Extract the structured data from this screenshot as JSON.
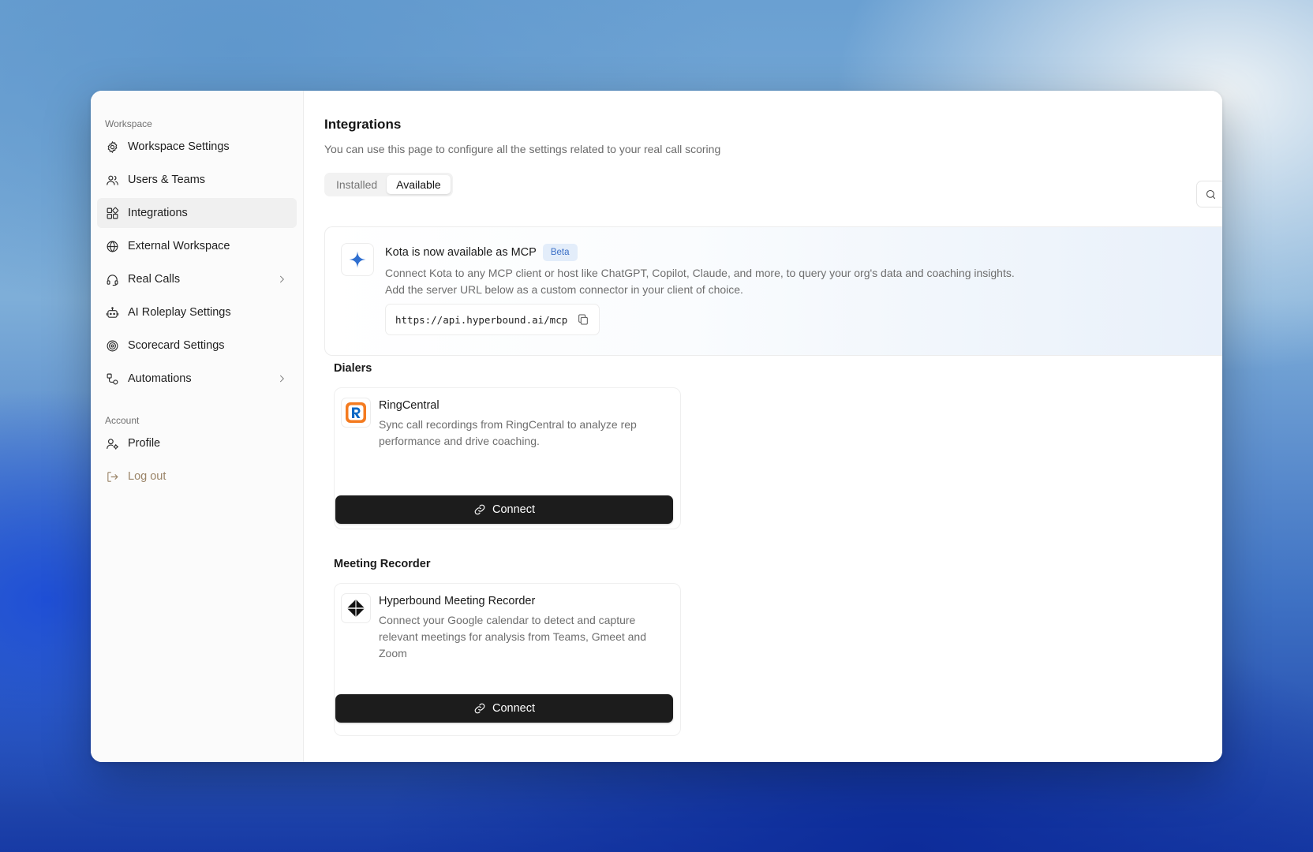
{
  "sidebar": {
    "workspace_label": "Workspace",
    "account_label": "Account",
    "items": [
      {
        "label": "Workspace Settings",
        "icon": "gear-icon"
      },
      {
        "label": "Users & Teams",
        "icon": "users-icon"
      },
      {
        "label": "Integrations",
        "icon": "integrations-icon",
        "active": true
      },
      {
        "label": "External Workspace",
        "icon": "globe-icon"
      },
      {
        "label": "Real Calls",
        "icon": "headset-icon",
        "has_submenu": true
      },
      {
        "label": "AI Roleplay Settings",
        "icon": "bot-icon"
      },
      {
        "label": "Scorecard Settings",
        "icon": "target-icon"
      },
      {
        "label": "Automations",
        "icon": "workflow-icon",
        "has_submenu": true
      }
    ],
    "account_items": [
      {
        "label": "Profile",
        "icon": "user-gear-icon"
      },
      {
        "label": "Log out",
        "icon": "logout-icon"
      }
    ]
  },
  "main": {
    "title": "Integrations",
    "subtitle": "You can use this page to configure all the settings related to your real call scoring",
    "tabs": [
      {
        "label": "Installed",
        "active": false
      },
      {
        "label": "Available",
        "active": true
      }
    ],
    "mcp": {
      "title": "Kota is now available as MCP",
      "badge": "Beta",
      "desc_line1": "Connect Kota to any MCP client or host like ChatGPT, Copilot, Claude, and more, to query your org's data and coaching insights.",
      "desc_line2": "Add the server URL below as a custom connector in your client of choice.",
      "url": "https://api.hyperbound.ai/mcp"
    },
    "groups": [
      {
        "title": "Dialers",
        "card": {
          "name": "RingCentral",
          "desc": "Sync call recordings from RingCentral to analyze rep performance and drive coaching.",
          "button": "Connect",
          "logo": "ringcentral-logo"
        }
      },
      {
        "title": "Meeting Recorder",
        "card": {
          "name": "Hyperbound Meeting Recorder",
          "desc": "Connect your Google calendar to detect and capture relevant meetings for analysis from Teams, Gmeet and Zoom",
          "button": "Connect",
          "logo": "hyperbound-logo"
        }
      }
    ]
  },
  "colors": {
    "accent_blue": "#3b6fc6",
    "button_dark": "#1c1c1c",
    "ringcentral_orange": "#f47b20",
    "ringcentral_blue": "#0b67c5"
  }
}
